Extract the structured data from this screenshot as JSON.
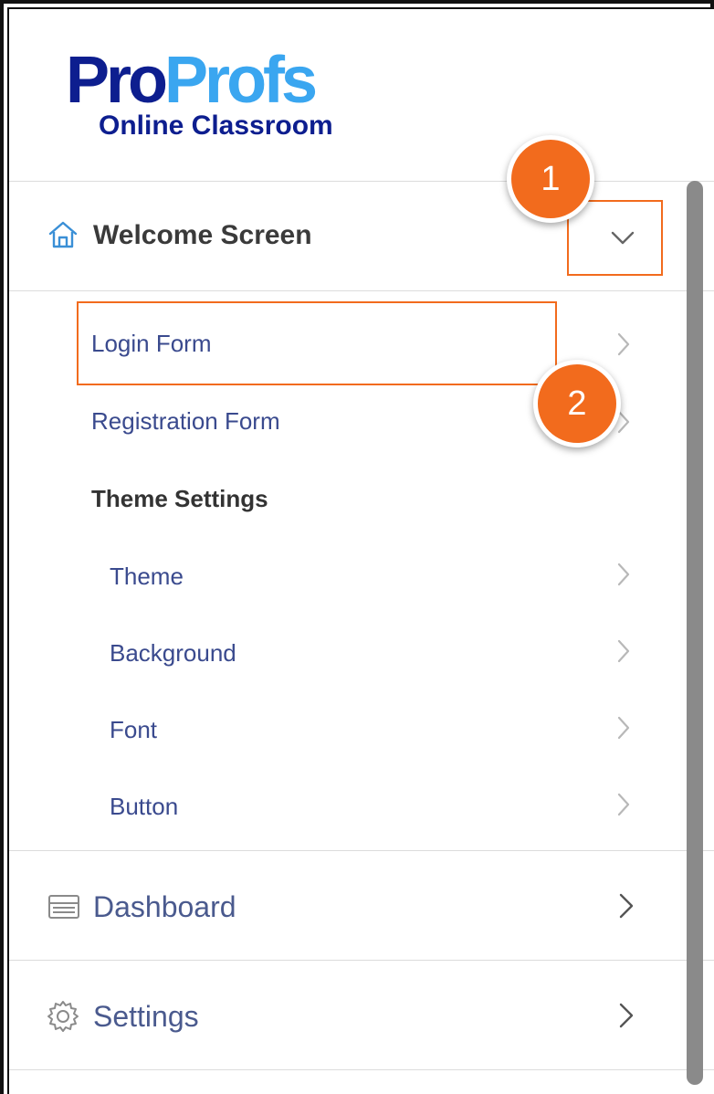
{
  "logo": {
    "brand_part1": "Pro",
    "brand_part2": "Profs",
    "subtitle": "Online Classroom"
  },
  "welcome": {
    "label": "Welcome Screen",
    "icon": "home-icon",
    "toggle_icon": "chevron-down-icon"
  },
  "submenu": {
    "login_form": "Login Form",
    "registration_form": "Registration Form",
    "theme_settings": "Theme Settings",
    "theme": "Theme",
    "background": "Background",
    "font": "Font",
    "button": "Button"
  },
  "nav": {
    "dashboard": "Dashboard",
    "settings": "Settings"
  },
  "annotations": {
    "badge1": "1",
    "badge2": "2"
  },
  "colors": {
    "brand_dark": "#0d1e8f",
    "brand_light": "#3aa6f0",
    "accent": "#f26b1d",
    "link_text": "#3a4a8e"
  }
}
